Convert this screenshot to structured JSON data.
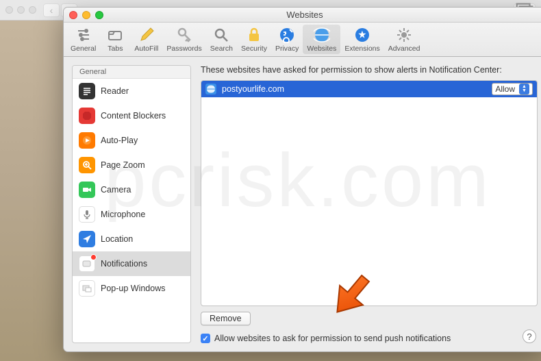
{
  "window": {
    "title": "Websites"
  },
  "toolbar": [
    {
      "id": "general",
      "label": "General"
    },
    {
      "id": "tabs",
      "label": "Tabs"
    },
    {
      "id": "autofill",
      "label": "AutoFill"
    },
    {
      "id": "passwords",
      "label": "Passwords"
    },
    {
      "id": "search",
      "label": "Search"
    },
    {
      "id": "security",
      "label": "Security"
    },
    {
      "id": "privacy",
      "label": "Privacy"
    },
    {
      "id": "websites",
      "label": "Websites"
    },
    {
      "id": "extensions",
      "label": "Extensions"
    },
    {
      "id": "advanced",
      "label": "Advanced"
    }
  ],
  "sidebar": {
    "header": "General",
    "items": [
      {
        "id": "reader",
        "label": "Reader"
      },
      {
        "id": "content-blockers",
        "label": "Content Blockers"
      },
      {
        "id": "auto-play",
        "label": "Auto-Play"
      },
      {
        "id": "page-zoom",
        "label": "Page Zoom"
      },
      {
        "id": "camera",
        "label": "Camera"
      },
      {
        "id": "microphone",
        "label": "Microphone"
      },
      {
        "id": "location",
        "label": "Location"
      },
      {
        "id": "notifications",
        "label": "Notifications",
        "badge": true,
        "selected": true
      },
      {
        "id": "popup-windows",
        "label": "Pop-up Windows"
      }
    ]
  },
  "main": {
    "description": "These websites have asked for permission to show alerts in Notification Center:",
    "sites": [
      {
        "domain": "postyourlife.com",
        "permission": "Allow"
      }
    ],
    "remove_label": "Remove",
    "checkbox_label": "Allow websites to ask for permission to send push notifications",
    "checkbox_checked": true
  },
  "help_label": "?"
}
